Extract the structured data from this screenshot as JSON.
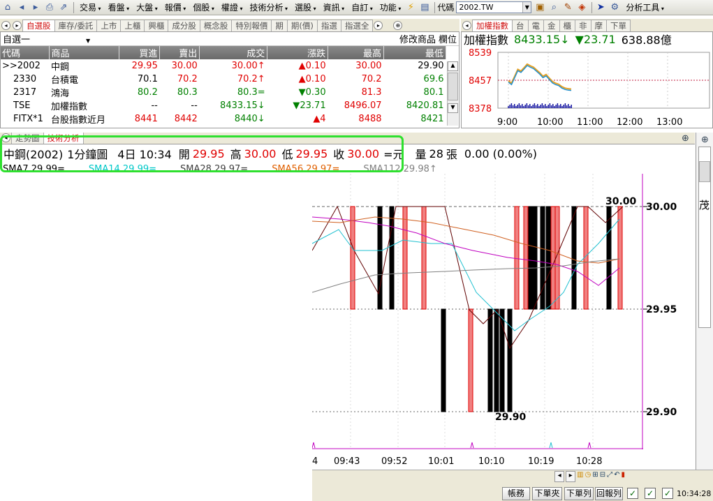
{
  "toolbar": {
    "menus": [
      "交易",
      "看盤",
      "大盤",
      "報價",
      "個股",
      "權證",
      "技術分析",
      "選股",
      "資訊",
      "自訂",
      "功能"
    ],
    "code_label": "代碼",
    "code_value": "2002.TW",
    "analysis_tool": "分析工具"
  },
  "watch": {
    "tabs": [
      "自選股",
      "庫存/委託",
      "上市",
      "上櫃",
      "興櫃",
      "成分股",
      "概念股",
      "特別報價",
      "期",
      "期(價)",
      "指選",
      "指選全"
    ],
    "list_name": "自選一",
    "modify_label": "修改商品",
    "field_label": "欄位",
    "columns": [
      "代碼",
      "商品",
      "買進",
      "賣出",
      "成交",
      "漲跌",
      "最高",
      "最低"
    ],
    "rows": [
      {
        "code": ">>2002",
        "name": "中鋼",
        "bid": "29.95",
        "ask": "30.00",
        "last": "30.00↑",
        "chg": "▲0.10",
        "high": "30.00",
        "low": "29.90",
        "c": [
          "red",
          "red",
          "red",
          "red",
          "red",
          "blk"
        ]
      },
      {
        "code": "2330",
        "name": "台積電",
        "bid": "70.1",
        "ask": "70.2",
        "last": "70.2↑",
        "chg": "▲0.10",
        "high": "70.2",
        "low": "69.6",
        "c": [
          "blk",
          "red",
          "red",
          "red",
          "red",
          "green"
        ]
      },
      {
        "code": "2317",
        "name": "鴻海",
        "bid": "80.2",
        "ask": "80.3",
        "last": "80.3=",
        "chg": "▼0.30",
        "high": "81.3",
        "low": "80.1",
        "c": [
          "green",
          "green",
          "green",
          "green",
          "red",
          "green"
        ]
      },
      {
        "code": "TSE",
        "name": "加權指數",
        "bid": "--",
        "ask": "--",
        "last": "8433.15↓",
        "chg": "▼23.71",
        "high": "8496.07",
        "low": "8420.81",
        "c": [
          "blk",
          "blk",
          "green",
          "green",
          "red",
          "green"
        ]
      },
      {
        "code": "FITX*1",
        "name": "台股指數近月",
        "bid": "8441",
        "ask": "8442",
        "last": "8440↓",
        "chg": "▲4",
        "high": "8488",
        "low": "8421",
        "c": [
          "red",
          "red",
          "green",
          "red",
          "red",
          "green"
        ]
      }
    ]
  },
  "mini": {
    "tabs": [
      "加權指數",
      "台",
      "電",
      "金",
      "櫃",
      "非",
      "摩",
      "下單"
    ],
    "title": "加權指數",
    "value": "8433.15↓",
    "change": "▼23.71",
    "volume": "638.88億",
    "y_ticks": [
      "8539",
      "8457",
      "8378"
    ],
    "x_ticks": [
      "9:00",
      "10:00",
      "11:00",
      "12:00",
      "13:00"
    ],
    "series": [
      8457,
      8450,
      8470,
      8490,
      8485,
      8495,
      8505,
      8500,
      8496,
      8488,
      8480,
      8470,
      8475,
      8465,
      8455,
      8450,
      8447,
      8440,
      8436,
      8434,
      8433
    ]
  },
  "lower": {
    "tabs": [
      "走勢圖",
      "技術分析"
    ],
    "stock": "中鋼(2002)",
    "period": "1分鐘圖",
    "date": "4日 10:34",
    "open_label": "開",
    "open": "29.95",
    "high_label": "高",
    "high": "30.00",
    "low_label": "低",
    "low": "29.95",
    "close_label": "收",
    "close": "30.00",
    "eq": "=元",
    "vol_label": "量",
    "vol": "28",
    "vol_unit": "張",
    "change": "0.00 (0.00%)",
    "sma": [
      {
        "label": "SMA7 29.99=",
        "color": "#000000"
      },
      {
        "label": "SMA14 29.99=",
        "color": "#00c8c8"
      },
      {
        "label": "SMA28 29.97=",
        "color": "#404040"
      },
      {
        "label": "SMA56 29.97=",
        "color": "#e06000"
      },
      {
        "label": "SMA112 29.98↑",
        "color": "#808080"
      }
    ]
  },
  "chart_data": {
    "type": "bar",
    "title": "中鋼(2002) 1分鐘圖",
    "y_ticks": [
      "30.00",
      "29.95",
      "29.90"
    ],
    "ylim": [
      29.885,
      30.015
    ],
    "x_ticks": [
      "09:43",
      "09:52",
      "10:01",
      "10:10",
      "10:19",
      "10:28"
    ],
    "partial_tick": "4",
    "hi_label": "30.00",
    "lo_label": "29.90",
    "bars": [
      {
        "dir": "up",
        "top": 30.0,
        "bot": 29.95
      },
      {
        "dir": "dn",
        "top": 30.0,
        "bot": 29.95
      },
      {
        "dir": "dn",
        "top": 30.0,
        "bot": 29.95
      },
      {
        "dir": "up",
        "top": 30.0,
        "bot": 29.95
      },
      {
        "dir": "up",
        "top": 30.0,
        "bot": 29.95
      },
      {
        "dir": "dn",
        "top": 29.95,
        "bot": 29.9
      },
      {
        "dir": "up",
        "top": 29.95,
        "bot": 29.9
      },
      {
        "dir": "dn",
        "top": 29.95,
        "bot": 29.9
      },
      {
        "dir": "dn",
        "top": 29.95,
        "bot": 29.9
      },
      {
        "dir": "dn",
        "top": 29.95,
        "bot": 29.9
      },
      {
        "dir": "dn",
        "top": 29.95,
        "bot": 29.9
      },
      {
        "dir": "up",
        "top": 30.0,
        "bot": 29.95
      },
      {
        "dir": "up",
        "top": 30.0,
        "bot": 29.95
      },
      {
        "dir": "dn",
        "top": 30.0,
        "bot": 29.95
      },
      {
        "dir": "dn",
        "top": 30.0,
        "bot": 29.95
      },
      {
        "dir": "dn",
        "top": 30.0,
        "bot": 29.95
      },
      {
        "dir": "dn",
        "top": 30.0,
        "bot": 29.95
      },
      {
        "dir": "up",
        "top": 30.0,
        "bot": 29.95
      },
      {
        "dir": "up",
        "top": 30.0,
        "bot": 29.95
      },
      {
        "dir": "dn",
        "top": 30.0,
        "bot": 29.95
      },
      {
        "dir": "up",
        "top": 30.0,
        "bot": 29.95
      },
      {
        "dir": "dn",
        "top": 30.0,
        "bot": 29.95
      },
      {
        "dir": "up",
        "top": 30.0,
        "bot": 29.95
      }
    ]
  },
  "status": {
    "buttons": [
      "帳務",
      "下單夾",
      "下單列",
      "回報列"
    ],
    "time": "10:34:28"
  },
  "right_panel": {
    "label": "茂"
  }
}
